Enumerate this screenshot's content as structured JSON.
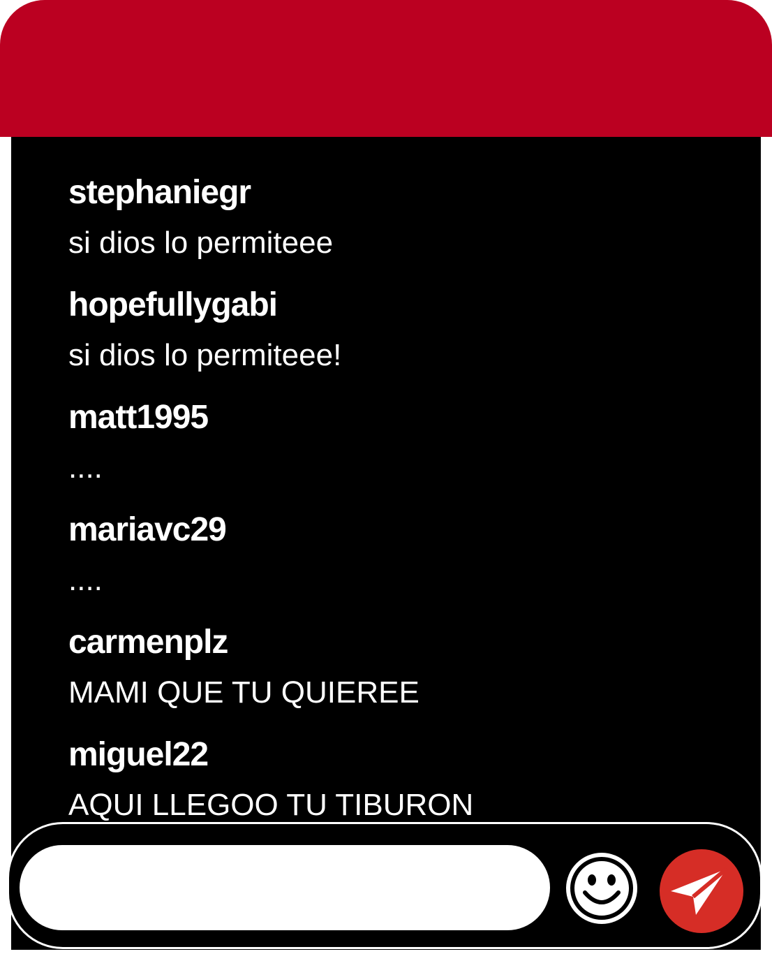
{
  "colors": {
    "header": "#bb0021",
    "send_button": "#d62d26",
    "background": "#000000",
    "text": "#ffffff"
  },
  "messages": [
    {
      "user": "stephaniegr",
      "text": "si dios lo permiteee"
    },
    {
      "user": "hopefullygabi",
      "text": "si dios lo permiteee!"
    },
    {
      "user": "matt1995",
      "text": "...."
    },
    {
      "user": "mariavc29",
      "text": "...."
    },
    {
      "user": "carmenplz",
      "text": "MAMI QUE TU QUIEREE"
    },
    {
      "user": "miguel22",
      "text": "AQUI LLEGOO TU TIBURON"
    }
  ],
  "composer": {
    "value": "",
    "placeholder": "",
    "emoji_icon": "smiley-face-icon",
    "send_icon": "paper-plane-icon"
  }
}
